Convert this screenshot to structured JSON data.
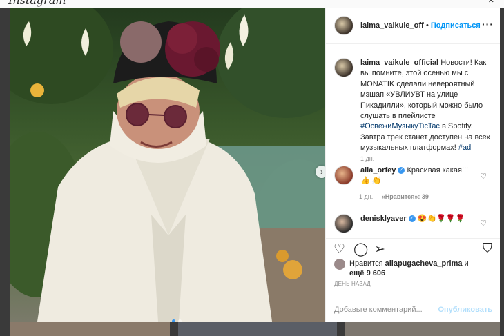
{
  "top": {
    "logo": "Instagram"
  },
  "header": {
    "username": "laima_vaikule_offic",
    "separator": "•",
    "follow_label": "Подписаться",
    "more_label": "···"
  },
  "caption": {
    "username": "laima_vaikule_official",
    "text_1": "Новости! Как вы помните, этой осенью мы с MONATIK сделали невероятный мэшап «УВЛИУВТ на улице Пикадилли», который можно было слушать в плейлисте ",
    "hashtag_1": "#ОсвежиМузыкуTicTac",
    "text_2": " в Spotify. Завтра трек станет доступен на всех музыкальных платформах! ",
    "hashtag_2": "#ad",
    "time": "1 дн."
  },
  "comments": [
    {
      "username": "alla_orfey",
      "verified": "✓",
      "text": "Красивая какая!!!👍 👏",
      "time": "1 дн.",
      "likes": "«Нравится»: 39"
    },
    {
      "username": "deniskl​yaver",
      "verified": "✓",
      "text": "😍👏🌹🌹🌹"
    }
  ],
  "likes": {
    "prefix": "Нравится ",
    "user": "allapugacheva_prima",
    "middle": " и",
    "more": "ещё 9 606"
  },
  "ago": "ДЕНЬ НАЗАД",
  "add_comment": {
    "placeholder": "Добавьте комментарий...",
    "publish_label": "Опубликовать"
  },
  "colors": {
    "accent": "#0095f6",
    "publish_disabled": "#b2dffc",
    "muted": "#8e8e8e"
  }
}
